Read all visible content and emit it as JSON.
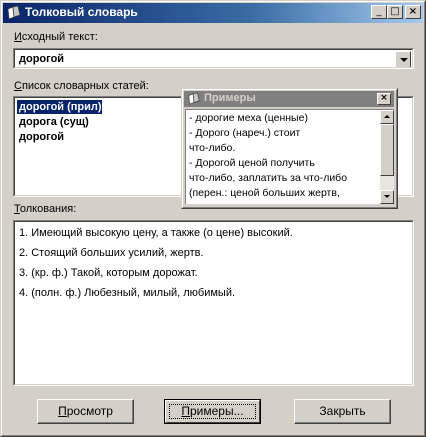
{
  "window": {
    "title": "Толковый словарь",
    "controls": {
      "minimize": "_",
      "maximize": "□",
      "close": "×"
    }
  },
  "source_text": {
    "label_underlined": "И",
    "label_rest": "сходный текст:",
    "value": "дорогой"
  },
  "entries": {
    "label_underlined": "С",
    "label_rest": "писок словарных статей:",
    "items": [
      {
        "label": "дорогой (прил)",
        "selected": true
      },
      {
        "label": "дорога (сущ)",
        "selected": false
      },
      {
        "label": "дорогой",
        "selected": false
      }
    ]
  },
  "definitions": {
    "label_underlined": "Т",
    "label_rest": "олкования:",
    "items": [
      "1.  Имеющий высокую цену, а также (о цене) высокий.",
      "2.  Стоящий больших усилий, жертв.",
      "3.  (кр. ф.) Такой, которым дорожат.",
      "4.  (полн. ф.) Любезный, милый, любимый."
    ]
  },
  "buttons": {
    "preview_underlined": "П",
    "preview_rest": "росмотр",
    "examples_underlined": "П",
    "examples_rest": "римеры...",
    "close": "Закрыть"
  },
  "examples_popup": {
    "title": "Примеры",
    "close": "×",
    "lines": [
      "- дорогие меха (ценные)",
      "- Дорого (нареч.) стоит",
      "что-либо.",
      "- Дорогой ценой получить",
      "что-либо, заплатить за что-либо",
      "(перен.: ценой больших жертв,"
    ]
  },
  "colors": {
    "title_active": "#0a246a",
    "title_inactive": "#808080",
    "face": "#d4d0c8",
    "selection": "#0a246a"
  }
}
